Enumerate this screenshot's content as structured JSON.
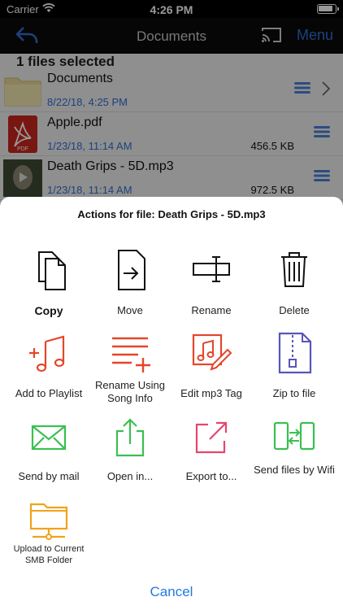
{
  "status": {
    "carrier": "Carrier",
    "time": "4:26 PM"
  },
  "navbar": {
    "title": "Documents",
    "menu_label": "Menu"
  },
  "list": {
    "selected_text": "1 files selected",
    "rows": [
      {
        "name": "Documents",
        "date": "8/22/18, 4:25 PM",
        "size": ""
      },
      {
        "name": "Apple.pdf",
        "date": "1/23/18, 11:14 AM",
        "size": "456.5 KB",
        "badge": "PDF"
      },
      {
        "name": "Death Grips - 5D.mp3",
        "date": "1/23/18, 11:14 AM",
        "size": "972.5 KB"
      }
    ]
  },
  "sheet": {
    "title": "Actions for file: Death Grips - 5D.mp3",
    "actions": [
      {
        "label": "Copy",
        "icon": "copy-icon"
      },
      {
        "label": "Move",
        "icon": "move-icon"
      },
      {
        "label": "Rename",
        "icon": "rename-icon"
      },
      {
        "label": "Delete",
        "icon": "trash-icon"
      },
      {
        "label": "Add to Playlist",
        "icon": "playlist-icon"
      },
      {
        "label": "Rename Using Song Info",
        "icon": "rename-song-icon"
      },
      {
        "label": "Edit mp3 Tag",
        "icon": "edit-tag-icon"
      },
      {
        "label": "Zip to file",
        "icon": "zip-icon"
      },
      {
        "label": "Send by mail",
        "icon": "mail-icon"
      },
      {
        "label": "Open in...",
        "icon": "share-icon"
      },
      {
        "label": "Export to...",
        "icon": "export-icon"
      },
      {
        "label": "Send files by Wifi",
        "icon": "wifi-transfer-icon"
      },
      {
        "label": "Upload to Current SMB Folder",
        "icon": "smb-folder-icon"
      }
    ],
    "cancel_label": "Cancel"
  },
  "colors": {
    "accent_blue": "#1f7ae0",
    "red": "#e3462a",
    "green": "#3bbf52",
    "pink": "#e8456b",
    "purple": "#5a55b8",
    "orange": "#f2a219"
  }
}
